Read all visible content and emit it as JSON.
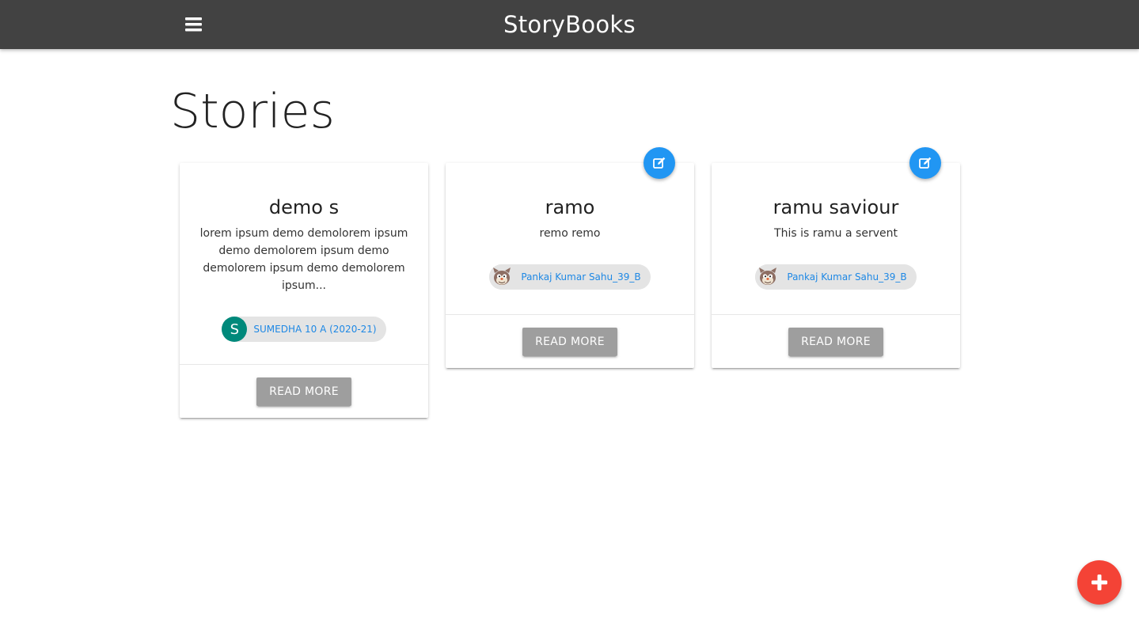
{
  "header": {
    "brand": "StoryBooks",
    "menu_icon": "hamburger-menu-icon",
    "background": "#424242"
  },
  "page": {
    "title": "Stories"
  },
  "stories": [
    {
      "title": "demo s",
      "excerpt": "lorem ipsum demo demolorem ipsum demo demolorem ipsum demo demolorem ipsum demo demolorem ipsum...",
      "author": "SUMEDHA 10 A (2020-21)",
      "author_avatar": "S",
      "button": "READ MORE",
      "editable": false
    },
    {
      "title": "ramo",
      "excerpt": "remo remo",
      "author": "Pankaj Kumar Sahu_39_B",
      "author_avatar": "cartoon-cat-avatar",
      "button": "READ MORE",
      "editable": true
    },
    {
      "title": "ramu saviour",
      "excerpt": "This is ramu a servent",
      "author": "Pankaj Kumar Sahu_39_B",
      "author_avatar": "cartoon-cat-avatar",
      "button": "READ MORE",
      "editable": true
    }
  ],
  "fab": {
    "icon": "plus-icon",
    "color": "#f44336"
  },
  "colors": {
    "edit_fab": "#2196f3",
    "chip_text": "#1e88e5",
    "button": "#9e9e9e",
    "avatar_letter_bg": "#00897b"
  }
}
